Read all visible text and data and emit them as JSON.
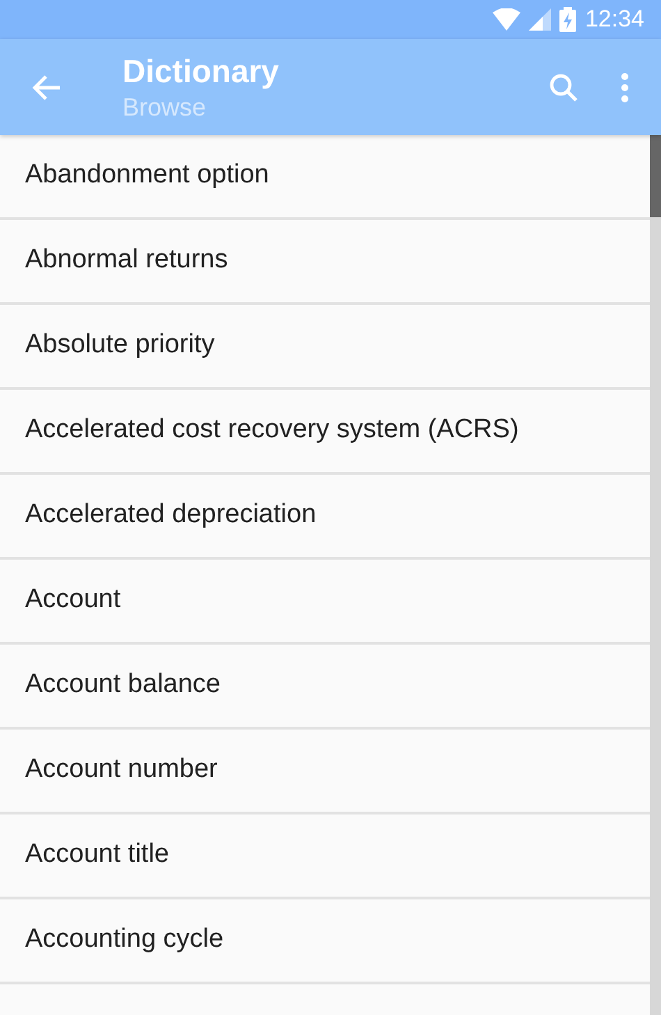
{
  "status_bar": {
    "time": "12:34"
  },
  "toolbar": {
    "title": "Dictionary",
    "subtitle": "Browse"
  },
  "terms": [
    "Abandonment option",
    "Abnormal returns",
    "Absolute priority",
    "Accelerated cost recovery system (ACRS)",
    "Accelerated depreciation",
    "Account",
    "Account balance",
    "Account number",
    "Account title",
    "Accounting cycle"
  ]
}
